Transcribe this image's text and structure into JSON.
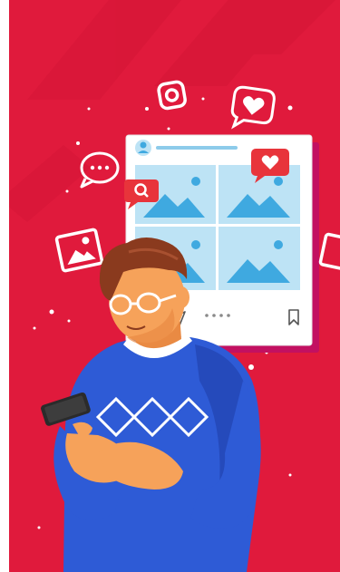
{
  "scene": {
    "description_free": true,
    "colors": {
      "background": "#E01A3C",
      "background_dark": "#C8102E",
      "card": "#FFFFFF",
      "card_shadow": "#C21061",
      "tile": "#BDE3F5",
      "mountain": "#3FA9E0",
      "heart_badge": "#E8343B",
      "shirt": "#2E5BD6",
      "shirt_dark": "#1F3FA8",
      "skin": "#F6A25A",
      "hair": "#8A3A1E",
      "phone": "#2B2B2B"
    },
    "icons": [
      "instagram-icon",
      "heart-bubble-icon",
      "chat-bubble-icon",
      "search-bubble-icon",
      "image-icon",
      "send-icon",
      "bookmark-icon"
    ]
  }
}
